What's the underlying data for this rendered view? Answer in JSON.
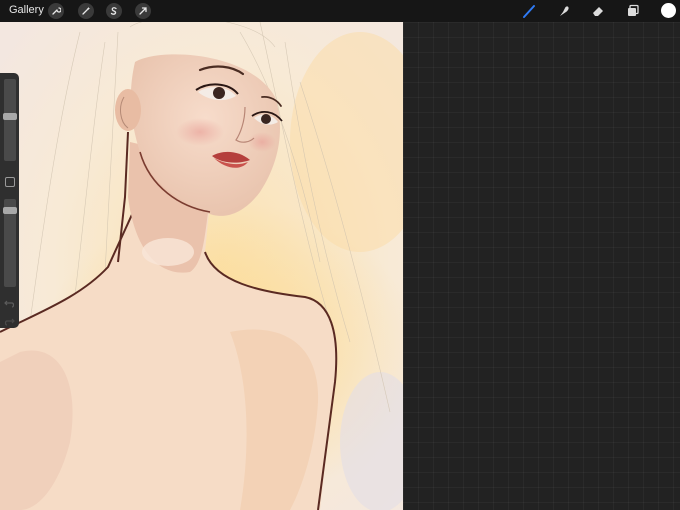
{
  "topbar": {
    "gallery_label": "Gallery",
    "left_tools": [
      "wrench-icon",
      "magic-wand-icon",
      "selection-icon",
      "transform-arrow-icon"
    ],
    "right_tools": [
      "brush-icon",
      "smudge-icon",
      "eraser-icon",
      "layers-icon"
    ],
    "active_tool": "brush-icon",
    "accent_color": "#2f7bf6",
    "current_color": "#ffffff"
  },
  "sidebar": {
    "brush_size_level": 0.55,
    "opacity_level": 0.9,
    "controls": [
      "brush-size-slider",
      "modify-button",
      "opacity-slider",
      "undo-icon",
      "redo-icon"
    ]
  },
  "canvas": {
    "background_color": "#f7eadc",
    "artwork": "portrait-illustration"
  }
}
